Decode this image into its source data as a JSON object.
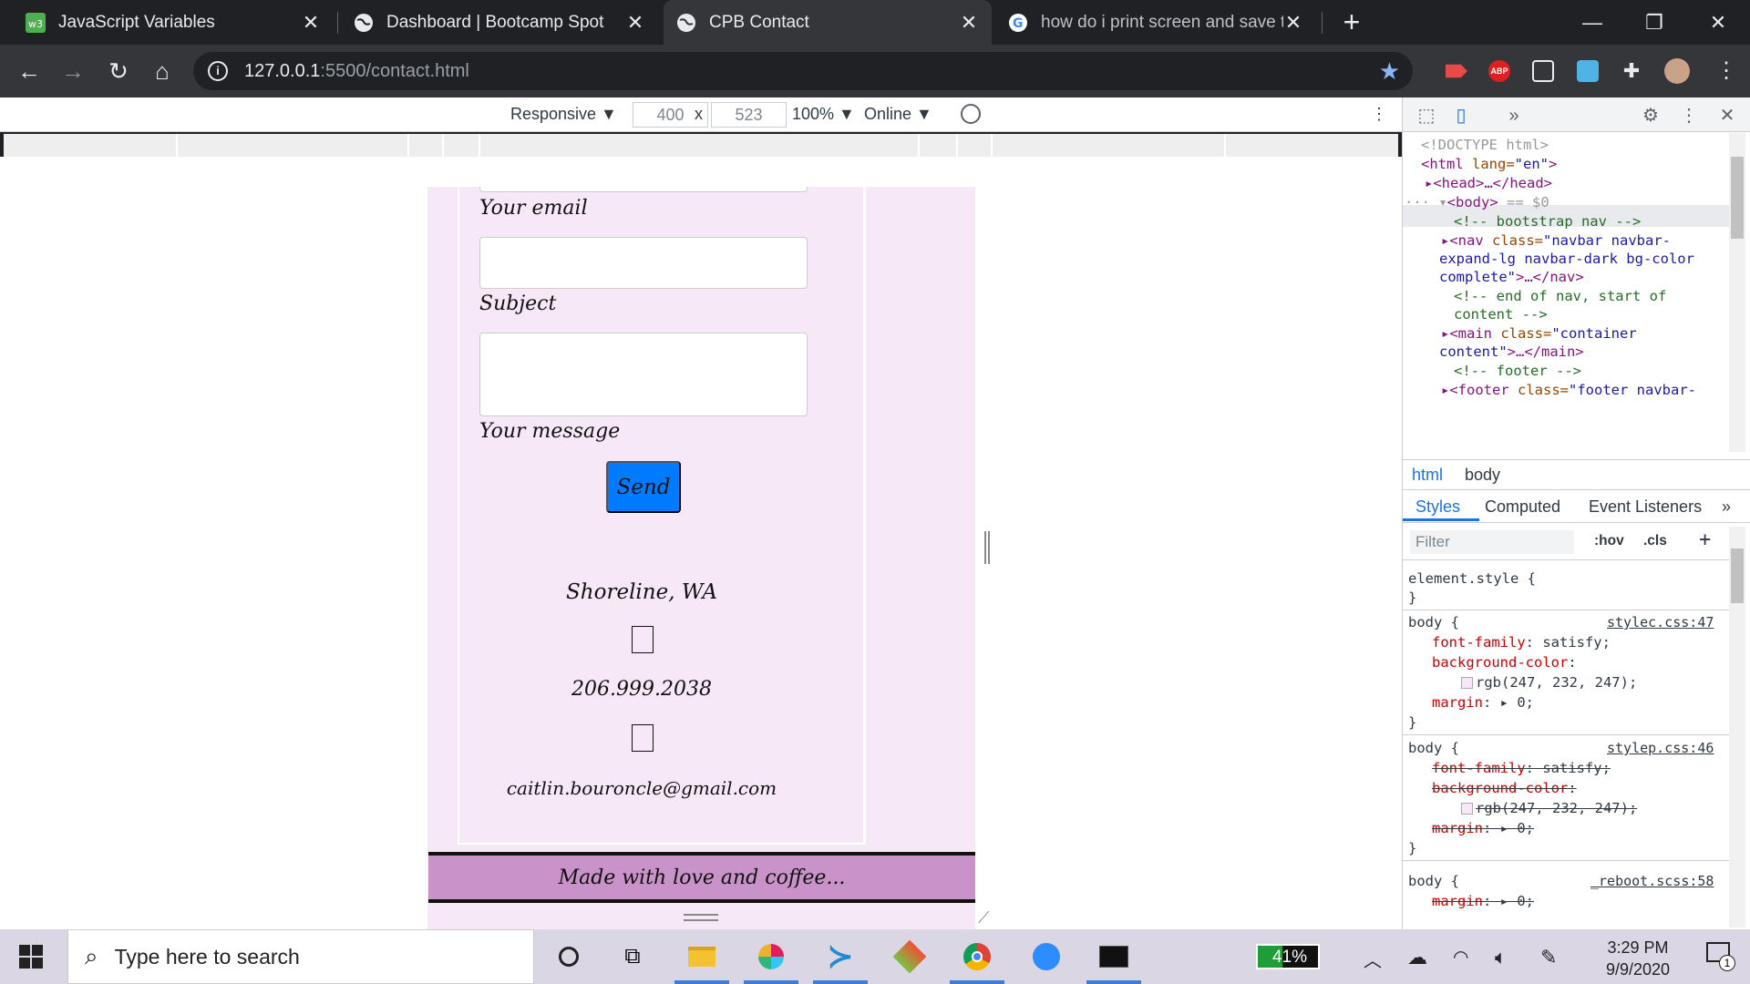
{
  "browser": {
    "tabs": [
      {
        "title": "JavaScript Variables",
        "close": "✕"
      },
      {
        "title": "Dashboard | Bootcamp Spot",
        "close": "✕"
      },
      {
        "title": "CPB Contact",
        "close": "✕"
      },
      {
        "title": "how do i print screen and save to",
        "close": "✕"
      }
    ],
    "new_tab": "+",
    "window_controls": {
      "minimize": "—",
      "restore": "❐",
      "close": "✕"
    },
    "url_host": "127.0.0.1",
    "url_rest": ":5500/contact.html",
    "extensions": {
      "abp": "ABP"
    }
  },
  "device_toolbar": {
    "mode": "Responsive ▼",
    "width": "400",
    "times": "x",
    "height": "523",
    "zoom": "100% ▼",
    "network": "Online ▼",
    "more": "⋮"
  },
  "page": {
    "labels": {
      "email": "Your email",
      "subject": "Subject",
      "message": "Your message"
    },
    "send_label": "Send",
    "location": "Shoreline, WA",
    "phone": "206.999.2038",
    "email": "caitlin.bouroncle@gmail.com",
    "footer": "Made with love and coffee..."
  },
  "devtools": {
    "elements": {
      "doctype": "<!DOCTYPE html>",
      "html_open_tag": "<html",
      "html_attr": " lang=",
      "html_val": "\"en\"",
      "html_close": ">",
      "head": "<head>…</head>",
      "body_tag": "<body>",
      "body_eq": " == $0",
      "c_nav": "<!-- bootstrap nav -->",
      "nav_tag": "<nav",
      "nav_attr": " class=",
      "nav_val1": "\"navbar navbar-",
      "nav_val2": "expand-lg navbar-dark bg-color",
      "nav_val3": "complete\"",
      "nav_end": ">…</nav>",
      "c_end1": "<!-- end of nav, start of",
      "c_end2": "content -->",
      "main_tag": "<main",
      "main_attr": " class=",
      "main_val1": "\"container",
      "main_val2": "content\"",
      "main_end": ">…</main>",
      "c_footer": "<!-- footer -->",
      "footer_tag": "<footer",
      "footer_attr": " class=",
      "footer_val": "\"footer navbar-"
    },
    "breadcrumbs": [
      "html",
      "body"
    ],
    "subtabs": [
      "Styles",
      "Computed",
      "Event Listeners",
      "»"
    ],
    "filter_placeholder": "Filter",
    "hov": ":hov",
    "cls": ".cls",
    "plus": "+",
    "styles": {
      "element_style": "element.style {",
      "close": "}",
      "body_sel": "body {",
      "src1": "stylec.css:47",
      "src2": "stylep.css:46",
      "src3": "_reboot.scss:58",
      "p_font": "font-family",
      "v_font": ": satisfy;",
      "p_bg": "background-color",
      "v_bg_colon": ":",
      "v_rgb": "rgb(247, 232, 247);",
      "p_margin": "margin",
      "v_margin": ": ▸ 0;"
    }
  },
  "taskbar": {
    "search_placeholder": "Type here to search",
    "battery": "41%",
    "time": "3:29 PM",
    "date": "9/9/2020",
    "notifications": "1"
  },
  "colors": {
    "page_bg": "#f7e8f7",
    "footer_bg": "#c993c9",
    "send_button": "#007bff"
  }
}
